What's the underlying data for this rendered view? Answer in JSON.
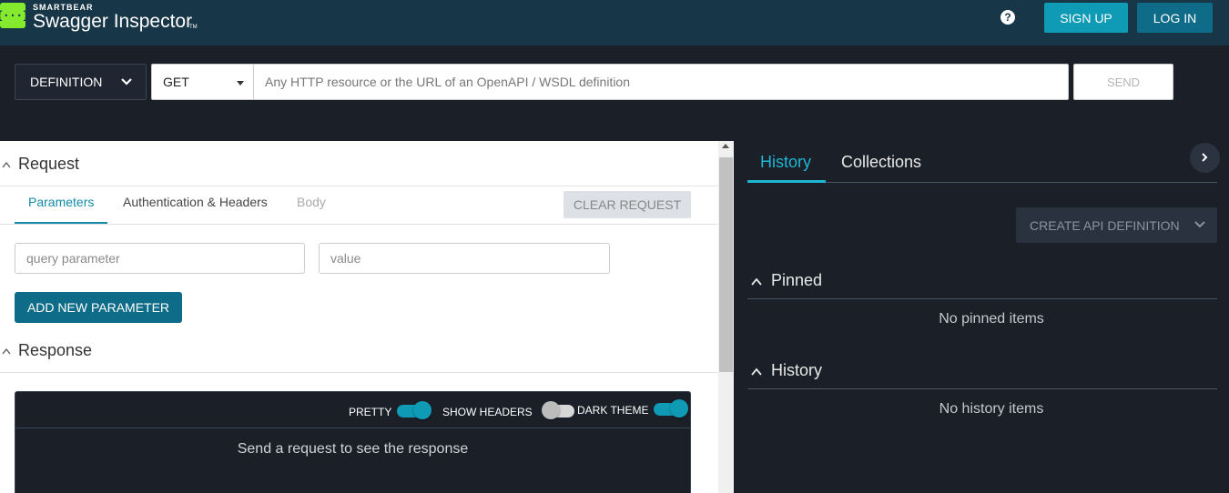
{
  "header": {
    "brand_top": "SMARTBEAR",
    "brand_name": "Swagger Inspector",
    "brand_tm": "TM",
    "logo_glyph": "{···}",
    "help_glyph": "?",
    "signup_label": "SIGN UP",
    "login_label": "LOG IN",
    "colors": {
      "bar": "#173647",
      "logo": "#85ea2d",
      "signup": "#0f9bb5",
      "login": "#0e6c88"
    }
  },
  "urlbar": {
    "definition_label": "DEFINITION",
    "method": "GET",
    "url_value": "",
    "url_placeholder": "Any HTTP resource or the URL of an OpenAPI / WSDL definition",
    "send_label": "SEND"
  },
  "request": {
    "title": "Request",
    "tabs": [
      "Parameters",
      "Authentication & Headers",
      "Body"
    ],
    "active_tab": "Parameters",
    "clear_label": "CLEAR REQUEST",
    "param_placeholder": "query parameter",
    "value_placeholder": "value",
    "add_param_label": "ADD NEW PARAMETER"
  },
  "response": {
    "title": "Response",
    "toggles": [
      {
        "label": "PRETTY",
        "on": true
      },
      {
        "label": "SHOW HEADERS",
        "on": false
      },
      {
        "label": "DARK THEME",
        "on": true
      }
    ],
    "empty_message": "Send a request to see the response"
  },
  "sidebar": {
    "tabs": [
      "History",
      "Collections"
    ],
    "active_tab": "History",
    "create_label": "CREATE API DEFINITION",
    "pinned_title": "Pinned",
    "pinned_empty": "No pinned items",
    "history_title": "History",
    "history_empty": "No history items",
    "accent": "#1fb6d3"
  }
}
